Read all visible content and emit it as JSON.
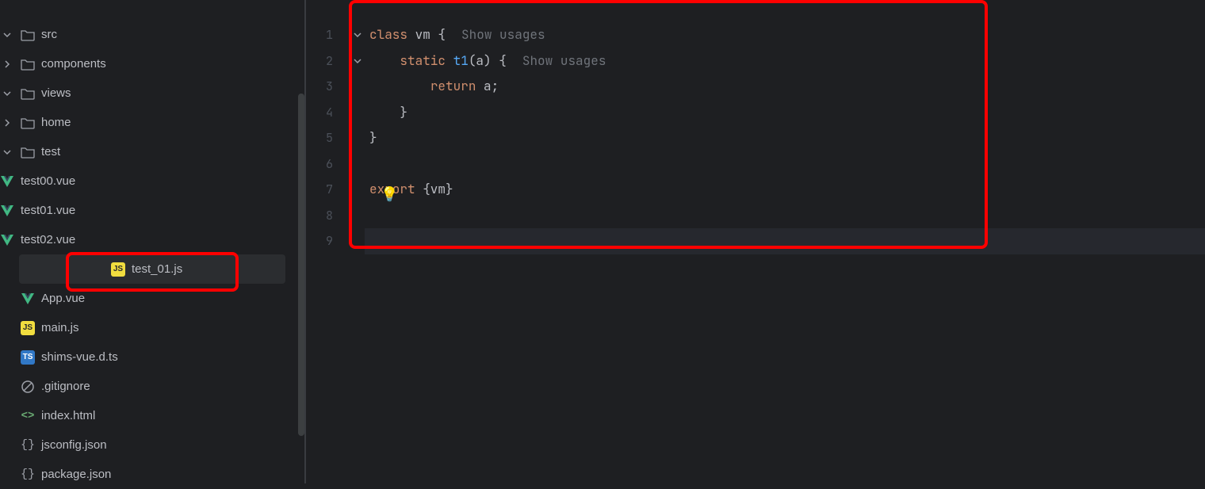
{
  "sidebar": {
    "items": {
      "src": "src",
      "components": "components",
      "views": "views",
      "home": "home",
      "test": "test",
      "test00": "test00.vue",
      "test01": "test01.vue",
      "test02": "test02.vue",
      "test_01_js": "test_01.js",
      "app_vue": "App.vue",
      "main_js": "main.js",
      "shims": "shims-vue.d.ts",
      "gitignore": ".gitignore",
      "index_html": "index.html",
      "jsconfig": "jsconfig.json",
      "package": "package.json"
    }
  },
  "gutter": [
    "1",
    "2",
    "3",
    "4",
    "5",
    "6",
    "7",
    "8",
    "9"
  ],
  "code": {
    "l1": {
      "kw": "class",
      "name": " vm ",
      "brace": "{",
      "hint": "Show usages"
    },
    "l2": {
      "pad": "    ",
      "kw": "static",
      "name": " ",
      "method": "t1",
      "args": "(a) {",
      "hint": "Show usages"
    },
    "l3": {
      "pad": "        ",
      "kw": "return",
      "rest": " a;"
    },
    "l4": "    }",
    "l5": "}",
    "l6": "",
    "l7": {
      "kw": "export",
      "rest": " {vm}"
    },
    "l8": "",
    "l9": ""
  },
  "icons": {
    "js": "JS",
    "ts": "TS"
  },
  "bulb": "💡"
}
